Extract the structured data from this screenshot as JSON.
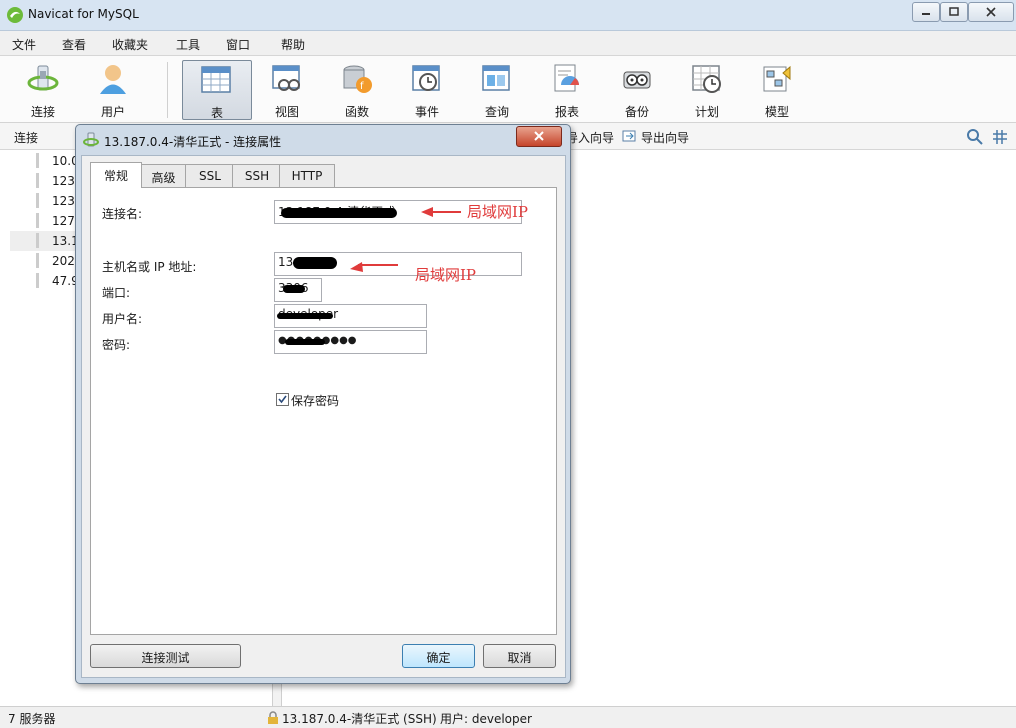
{
  "window": {
    "title": "Navicat for MySQL"
  },
  "menu": [
    "文件",
    "查看",
    "收藏夹",
    "工具",
    "窗口",
    "帮助"
  ],
  "toolbar": [
    {
      "label": "连接",
      "icon": "connection-icon"
    },
    {
      "label": "用户",
      "icon": "user-icon"
    },
    {
      "label": "表",
      "icon": "table-icon",
      "active": true
    },
    {
      "label": "视图",
      "icon": "view-icon"
    },
    {
      "label": "函数",
      "icon": "function-icon"
    },
    {
      "label": "事件",
      "icon": "event-icon"
    },
    {
      "label": "查询",
      "icon": "query-icon"
    },
    {
      "label": "报表",
      "icon": "report-icon"
    },
    {
      "label": "备份",
      "icon": "backup-icon"
    },
    {
      "label": "计划",
      "icon": "schedule-icon"
    },
    {
      "label": "模型",
      "icon": "model-icon"
    }
  ],
  "subbar": {
    "label": "连接",
    "import": "导入向导",
    "export": "导出向导"
  },
  "tree": [
    "10.0",
    "123",
    "123",
    "127",
    "13.1",
    "202",
    "47.9"
  ],
  "status": {
    "count": "7 服务器",
    "connection": "13.187.0.4-清华正式 (SSH)",
    "user": "用户: developer"
  },
  "dialog": {
    "title": "13.187.0.4-清华正式 - 连接属性",
    "tabs": [
      "常规",
      "高级",
      "SSL",
      "SSH",
      "HTTP"
    ],
    "fields": {
      "conn_name_label": "连接名:",
      "conn_name_value": "13.187.0.4-清华正式",
      "host_label": "主机名或 IP 地址:",
      "host_value": "13.187",
      "port_label": "端口:",
      "port_value": "3306",
      "user_label": "用户名:",
      "user_value": "developer",
      "password_label": "密码:",
      "password_value": "●●●●●●●●●"
    },
    "save_password": "保存密码",
    "buttons": {
      "test": "连接测试",
      "ok": "确定",
      "cancel": "取消"
    }
  },
  "annotations": {
    "a1": "局域网IP",
    "a2": "局域网IP"
  },
  "colors": {
    "accent": "#3c7fb1",
    "annotation": "#e03b3b"
  }
}
